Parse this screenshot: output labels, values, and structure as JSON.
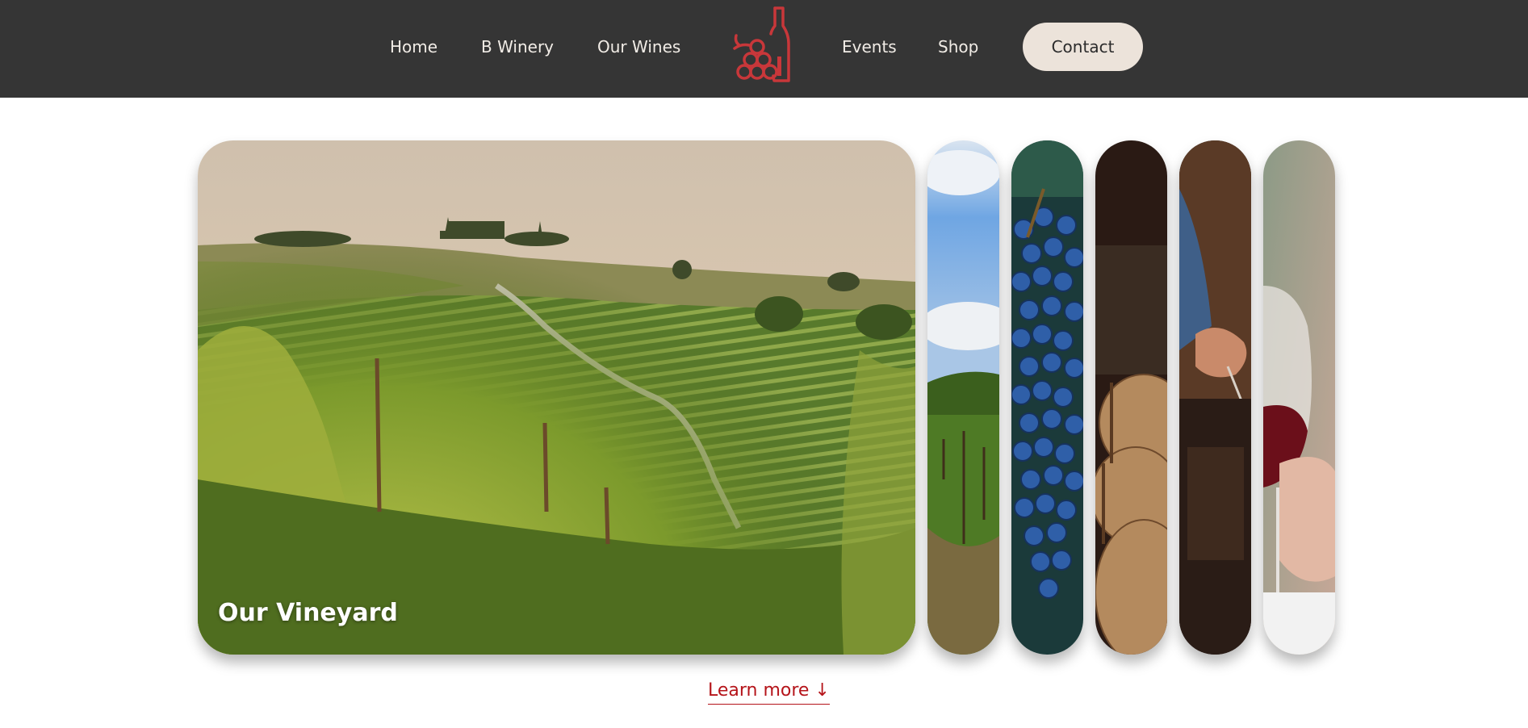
{
  "nav": {
    "items": [
      {
        "label": "Home"
      },
      {
        "label": "B Winery"
      },
      {
        "label": "Our Wines"
      },
      {
        "label": "Events"
      },
      {
        "label": "Shop"
      }
    ],
    "contact_label": "Contact",
    "logo_icon": "grapes-and-bottle-logo"
  },
  "colors": {
    "header_bg": "#353535",
    "nav_text": "#f1ece6",
    "contact_bg": "#ece3da",
    "logo": "#c8373a",
    "learn_more": "#b5141a"
  },
  "gallery": {
    "featured_title": "Our Vineyard",
    "panels": [
      {
        "image": "vineyard-hills-photo"
      },
      {
        "image": "sky-and-vines-photo"
      },
      {
        "image": "blue-grapes-photo"
      },
      {
        "image": "wine-barrels-photo"
      },
      {
        "image": "wine-tasting-hand-photo"
      },
      {
        "image": "red-wine-glass-photo"
      }
    ]
  },
  "learn_more_label": "Learn more ↓"
}
